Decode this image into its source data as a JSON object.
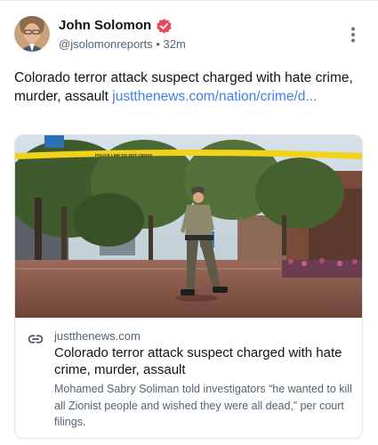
{
  "author": {
    "name": "John Solomon",
    "handle": "@jsolomonreports",
    "separator": "•",
    "time": "32m"
  },
  "post": {
    "text": "Colorado terror attack suspect charged with hate crime, murder, assault ",
    "link_text": "justthenews.com/nation/crime/d..."
  },
  "card": {
    "domain": "justthenews.com",
    "title": "Colorado terror attack suspect charged with hate crime, murder, assault",
    "description": "Mohamed Sabry Soliman told investigators “he wanted to kill all Zionist people and wished they were all dead,” per court filings.",
    "tape_text": "POLICE LINE DO NOT CROSS"
  },
  "colors": {
    "link": "#3d7fe8",
    "verified_badge": "#e8475f",
    "muted_text": "#536471"
  },
  "icons": [
    "verified-icon",
    "more-options-icon",
    "link-icon"
  ]
}
